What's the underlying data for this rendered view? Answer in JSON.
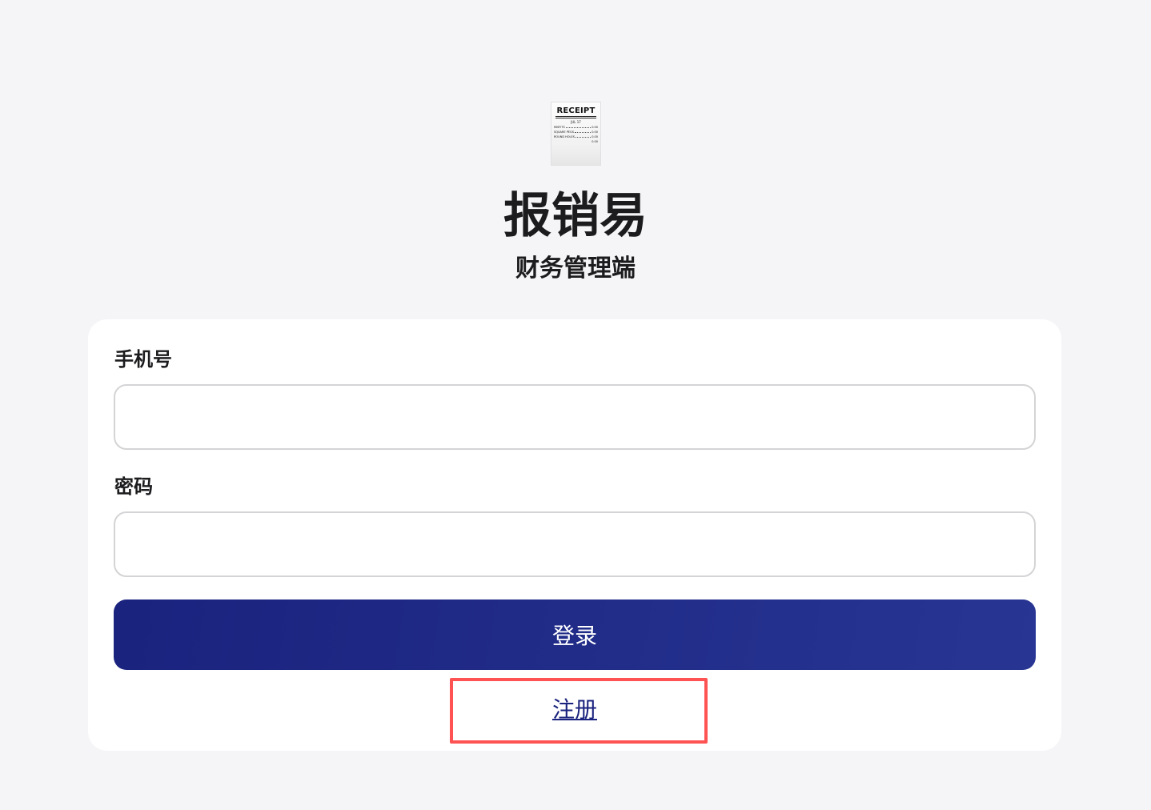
{
  "app": {
    "title": "报销易",
    "subtitle": "财务管理端"
  },
  "logo": {
    "icon": "receipt-icon",
    "heading": "RECEIPT",
    "date": "JUL 17",
    "lines": [
      {
        "label": "MISFITS",
        "amount": "0.00"
      },
      {
        "label": "SQUARE PEGS",
        "amount": "0.00"
      },
      {
        "label": "ROUND HOLES",
        "amount": "0.00"
      },
      {
        "label": "",
        "amount": "0.00"
      }
    ]
  },
  "form": {
    "phone_label": "手机号",
    "phone_value": "",
    "phone_placeholder": "",
    "password_label": "密码",
    "password_value": "",
    "password_placeholder": "",
    "login_label": "登录",
    "register_label": "注册"
  },
  "colors": {
    "primary": "#1a237e",
    "highlight": "#ff5252",
    "background": "#f5f5f7"
  }
}
